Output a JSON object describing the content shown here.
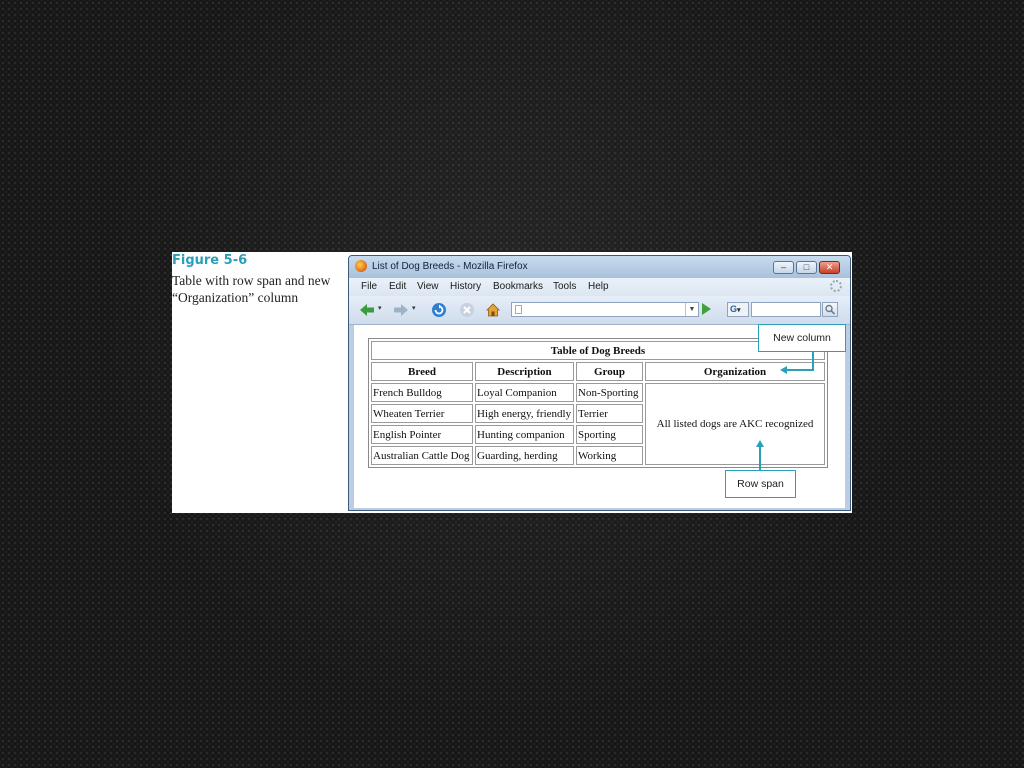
{
  "figure": {
    "label": "Figure 5-6",
    "caption": "Table with row span and new “Organization” column"
  },
  "browser": {
    "title": "List of Dog Breeds - Mozilla Firefox",
    "menu": [
      "File",
      "Edit",
      "View",
      "History",
      "Bookmarks",
      "Tools",
      "Help"
    ],
    "search_engine_label": "G",
    "url_value": "",
    "search_value": ""
  },
  "page": {
    "table_title": "Table of Dog Breeds",
    "headers": [
      "Breed",
      "Description",
      "Group",
      "Organization"
    ],
    "rows": [
      [
        "French Bulldog",
        "Loyal Companion",
        "Non-Sporting"
      ],
      [
        "Wheaten Terrier",
        "High energy, friendly",
        "Terrier"
      ],
      [
        "English Pointer",
        "Hunting companion",
        "Sporting"
      ],
      [
        "Australian Cattle Dog",
        "Guarding, herding",
        "Working"
      ]
    ],
    "spanned_cell": "All listed dogs are AKC recognized"
  },
  "callouts": {
    "new_column": "New column",
    "row_span": "Row span"
  },
  "colors": {
    "accent": "#2aa0b8",
    "titlebar": "#b9cde3"
  }
}
